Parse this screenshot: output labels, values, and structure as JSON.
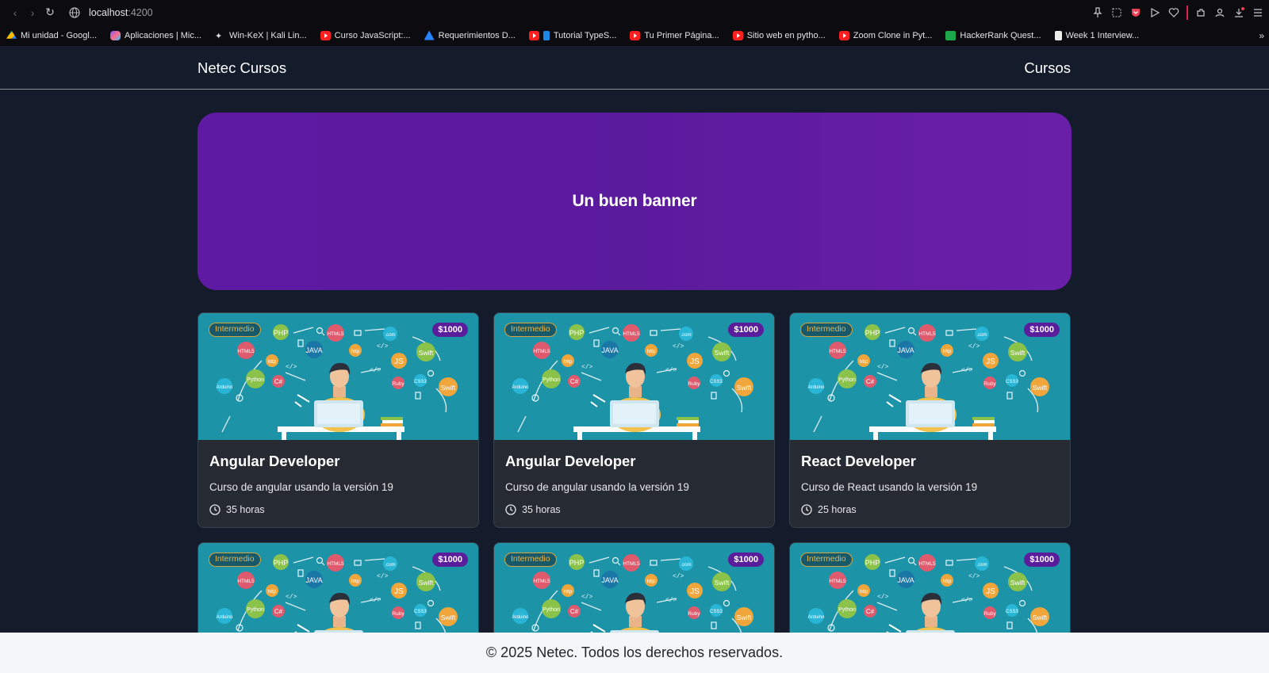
{
  "browser": {
    "url_host": "localhost",
    "url_port": ":4200",
    "bookmarks": [
      {
        "label": "Mi unidad - Googl...",
        "icon": "drive-icon"
      },
      {
        "label": "Aplicaciones | Mic...",
        "icon": "copilot-icon"
      },
      {
        "label": "Win-KeX | Kali Lin...",
        "icon": "kali-icon"
      },
      {
        "label": "Curso JavaScript:...",
        "icon": "youtube-icon"
      },
      {
        "label": "Requerimientos D...",
        "icon": "jira-icon"
      },
      {
        "label": "Tutorial TypeS...",
        "icon": "typescript-icon"
      },
      {
        "label": "Tu Primer Página...",
        "icon": "youtube-icon"
      },
      {
        "label": "Sitio web en pytho...",
        "icon": "youtube-icon"
      },
      {
        "label": "Zoom Clone in Pyt...",
        "icon": "youtube-icon"
      },
      {
        "label": "HackerRank Quest...",
        "icon": "hackerrank-icon"
      },
      {
        "label": "Week 1 Interview...",
        "icon": "document-icon"
      }
    ]
  },
  "navbar": {
    "brand": "Netec Cursos",
    "link": "Cursos"
  },
  "banner": {
    "title": "Un buen banner"
  },
  "cards": [
    {
      "level": "Intermedio",
      "price": "$1000",
      "title": "Angular Developer",
      "description": "Curso de angular usando la versión 19",
      "hours": "35 horas"
    },
    {
      "level": "Intermedio",
      "price": "$1000",
      "title": "Angular Developer",
      "description": "Curso de angular usando la versión 19",
      "hours": "35 horas"
    },
    {
      "level": "Intermedio",
      "price": "$1000",
      "title": "React Developer",
      "description": "Curso de React usando la versión 19",
      "hours": "25 horas"
    },
    {
      "level": "Intermedio",
      "price": "$1000"
    },
    {
      "level": "Intermedio",
      "price": "$1000"
    },
    {
      "level": "Intermedio",
      "price": "$1000"
    }
  ],
  "footer": {
    "text": "© 2025 Netec. Todos los derechos reservados."
  },
  "colors": {
    "page_bg": "#141b2b",
    "banner": "#5e1aa3",
    "card_bg": "#252a33",
    "image_bg": "#1d93a8",
    "level_badge": "#d7a33a",
    "price_badge": "#5a1d9c"
  }
}
